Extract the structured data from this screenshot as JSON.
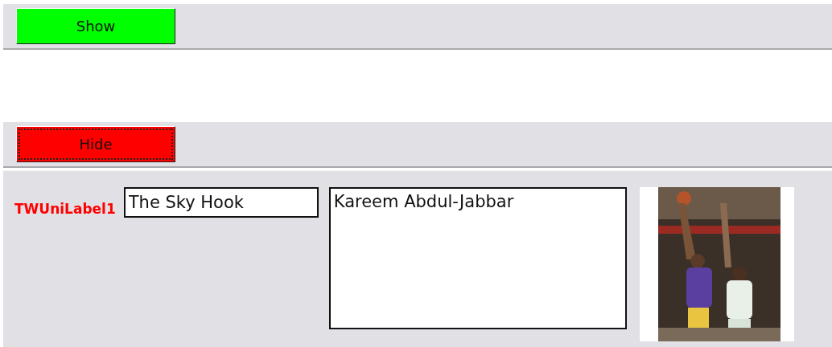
{
  "panels": [
    {
      "button": {
        "label": "Show",
        "color": "#00ff00",
        "focused": false
      }
    },
    {
      "button": {
        "label": "Hide",
        "color": "#ff0000",
        "focused": true
      }
    }
  ],
  "form": {
    "label": "TWUniLabel1",
    "title_field": {
      "value": "The Sky Hook"
    },
    "name_field": {
      "value": "Kareem Abdul-Jabbar"
    }
  }
}
